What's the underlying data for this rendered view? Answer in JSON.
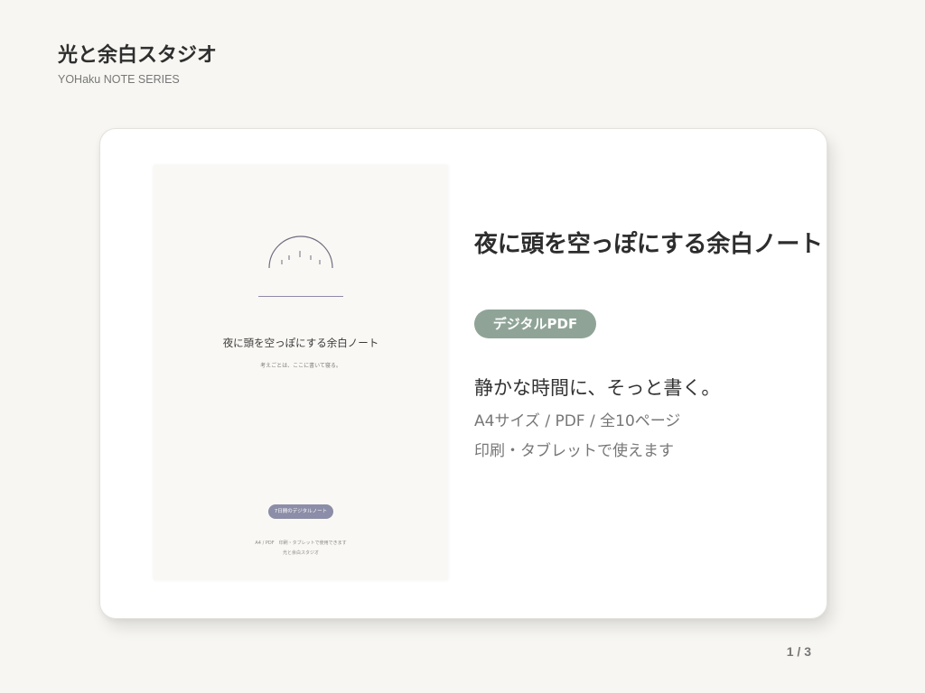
{
  "brand": {
    "title": "光と余白スタジオ",
    "subtitle": "YOHaku NOTE SERIES"
  },
  "preview": {
    "title": "夜に頭を空っぽにする余白ノート",
    "caption": "考えごとは、ここに書いて寝る。",
    "badge": "7日間のデジタルノート",
    "spec": "A4 / PDF　印刷・タブレットで使用できます",
    "brand": "光と余白スタジオ",
    "accent_color": "#8c8da8"
  },
  "product": {
    "title": "夜に頭を空っぽにする余白ノート",
    "format_badge": "デジタルPDF",
    "tagline": "静かな時間に、そっと書く。",
    "specs": [
      "A4サイズ / PDF / 全10ページ",
      "印刷・タブレットで使えます"
    ],
    "badge_color": "#8fa497"
  },
  "pagination": {
    "label": "1 / 3"
  }
}
